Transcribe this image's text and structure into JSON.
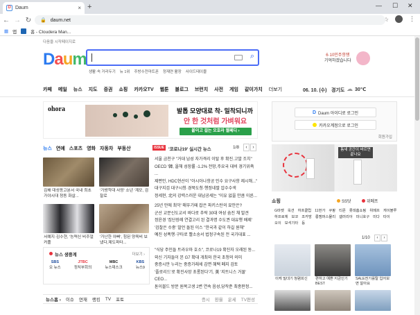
{
  "browser": {
    "tab_title": "Daum",
    "tab_close": "×",
    "new_tab": "+",
    "minimize": "—",
    "maximize": "☐",
    "close": "✕",
    "url": "daum.net",
    "bookmarks": [
      "앱",
      "홈 - Cloudera Man..."
    ]
  },
  "top_link": "다음을 시작페이지로",
  "logo": {
    "d": "D",
    "a": "a",
    "u": "u",
    "m": "m"
  },
  "search": {
    "keywords": [
      "생활·속 거리두기",
      "뉴 1위",
      "주방수전마트폰",
      "정재연 활장",
      "사이드테이블"
    ]
  },
  "promo": {
    "line1": "6·10민주항쟁",
    "line2": "기억하겠습니다"
  },
  "gnb": [
    "카페",
    "메일",
    "뉴스",
    "지도",
    "증권",
    "쇼핑",
    "카카오TV",
    "웹툰",
    "블로그",
    "브런치",
    "사전",
    "게임",
    "같이가치",
    "더보기"
  ],
  "date": "06. 10. (수)",
  "weather": {
    "region": "경기도",
    "temp": "30℃"
  },
  "ad": {
    "brand": "ohora",
    "line1": "발톱 모양대로 착- 밀착되니까",
    "line2": "안 한 것처럼 가벼워요",
    "cta": "붙이고 걸는 오호라 젤페디 ›"
  },
  "news_nav": {
    "label": "뉴스",
    "items": [
      "연예",
      "스포츠",
      "영화",
      "자동차",
      "부동산"
    ],
    "issue_badge": "ISSUE",
    "issue_text": "'코로나19' 실시간 뉴스",
    "page": "1/8"
  },
  "thumbs": [
    {
      "caption": "김해 대성동고분서 국내 최초 가야시대 청동 화살..."
    },
    {
      "caption": "'가방학대 사망' 소년 '계모, 검찰로"
    },
    {
      "caption": "서예지·김수현, '능력신 비주얼 커플"
    },
    {
      "caption": "'가난한 아빠', 힘된 양육비 보냈다,제도파타..."
    }
  ],
  "headlines": [
    "서울 금천구 \"거대 남성 자가격리 이탈 후 확진.고발 조치\"",
    "OECD '韓, 올해 성장률 -1.2% 전망,주요국 대비 경기위축 ...",
    "제편인, HDC현산이 \"아시아나항공 인수 요구사항 제시해...\"",
    "대구지검 대구시청·경북도청·행정네팔 압수수색",
    "정세현, 北의 강력스러운 대남공세는 \"이유 없을 만큼 이른...",
    "",
    "25년 만에 최악' 매뚜기떼 잡은 파키스탄의 묘안은?",
    "군산 교문신도교서 바다로 추락 30대 여성 숨진 채 발견",
    "정윤경 '집단장례 연결고리 된 결과명 수도권 대유행 배제'",
    "'검찰은 수중' 발언 돌된 이스 \"한국과 같이 하길 원해\"",
    "예진 성폭행·구타로 빨소송서 법정구속된 전 국가대표 ..."
  ],
  "headlines2": [
    "\"식당 주인들 트라우마 호소\", 코로나19 확진자 오래된 동...",
    "외신 기자들이 본 G7 확대 개최와 한국 초청의 의미",
    "중증시만 누리는 중증가래세 감면 혜택 폐지 검토",
    "'플로리드'로 확진사망 초롱된다'기, 美 '지트니스 거물' CEO...",
    "톤이블드 방문 원목고생 2변 연속 음성,당작준 최종판정..."
  ],
  "live": {
    "title": "뉴스 생중계",
    "more": "더보기 ›",
    "channels": [
      {
        "name": "SBS",
        "sub": "오 뉴스"
      },
      {
        "name": "JTBC",
        "sub": "정치부회의"
      },
      {
        "name": "MBC",
        "sub": "뉴스데스크"
      },
      {
        "name": "KBS",
        "sub": "뉴스9"
      }
    ]
  },
  "bottom_tabs": {
    "label": "뉴스홈 ›",
    "items": [
      "이슈",
      "연재",
      "랭킹",
      "TV",
      "포토"
    ],
    "right": [
      "증시",
      "환율",
      "운세",
      "TV편성"
    ]
  },
  "login": {
    "daum_btn": "Daum 아이디로 로그인",
    "kakao_btn": "카카오계정으로 로그인",
    "signup": "회원가입"
  },
  "right_ad": {
    "text": "틈새 공간이 바르면 끝나요"
  },
  "shopping": {
    "title": "쇼핑",
    "ss": "SS닷",
    "wemake": "위메프",
    "links": [
      "G마켓",
      "옥션",
      "하프클럽",
      "11번가",
      "쿠팡",
      "티몬",
      "롯데홈쇼핑",
      "위메프",
      "게이블루",
      "하프로체",
      "보코",
      "조카방",
      "롱캠머스몰리",
      "갤러리아",
      "미니호구",
      "미다",
      "타이",
      "오이",
      "보석기타",
      "등"
    ],
    "page": "1/10",
    "items": [
      {
        "caption": "이케 밀대기 청렴회신",
        "sub": ""
      },
      {
        "caption": "편하고 예쁜 지금인기BEST",
        "sub": ""
      },
      {
        "caption": "SALE전기롤탈 입어보면 알아요",
        "sub": ""
      }
    ]
  }
}
